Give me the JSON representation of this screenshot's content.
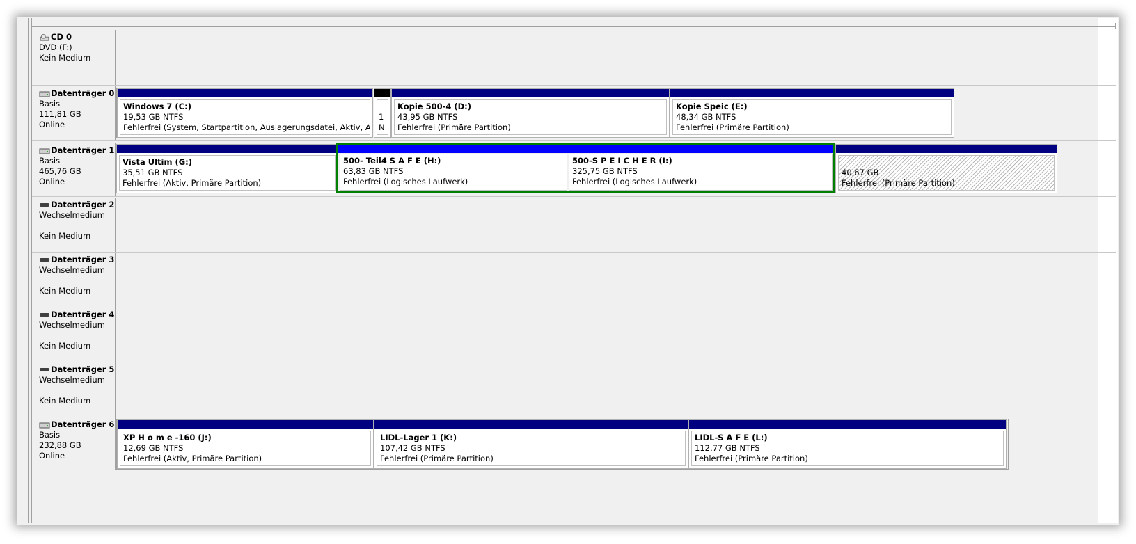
{
  "disks": [
    {
      "id": "cd0",
      "title": "CD 0",
      "icon": "cd-drive-icon",
      "lines": [
        "DVD (F:)",
        "",
        "Kein Medium"
      ]
    },
    {
      "id": "d0",
      "title": "Datenträger 0",
      "icon": "disk-icon",
      "lines": [
        "Basis",
        "111,81 GB",
        "Online"
      ],
      "partitions": [
        {
          "name": "Windows 7  (C:)",
          "size": "19,53 GB NTFS",
          "status": "Fehlerfrei (System, Startpartition, Auslagerungsdatei, Aktiv, Absturzabbild, Primäre Partition)"
        },
        {
          "name": "",
          "size": "1",
          "status": "N"
        },
        {
          "name": "Kopie 500-4  (D:)",
          "size": "43,95 GB NTFS",
          "status": "Fehlerfrei (Primäre Partition)"
        },
        {
          "name": "Kopie Speic  (E:)",
          "size": "48,34 GB NTFS",
          "status": "Fehlerfrei (Primäre Partition)"
        }
      ]
    },
    {
      "id": "d1",
      "title": "Datenträger 1",
      "icon": "disk-icon",
      "lines": [
        "Basis",
        "465,76 GB",
        "Online"
      ],
      "partitions": [
        {
          "name": "Vista Ultim  (G:)",
          "size": "35,51 GB NTFS",
          "status": "Fehlerfrei (Aktiv, Primäre Partition)"
        },
        {
          "name": "500- Teil4  S A F E  (H:)",
          "size": "63,83 GB NTFS",
          "status": "Fehlerfrei (Logisches Laufwerk)"
        },
        {
          "name": "500-S P E I C H E R  (I:)",
          "size": "325,75 GB NTFS",
          "status": "Fehlerfrei (Logisches Laufwerk)"
        },
        {
          "name": "",
          "size": "40,67 GB",
          "status": "Fehlerfrei (Primäre Partition)"
        }
      ]
    },
    {
      "id": "d2",
      "title": "Datenträger 2",
      "icon": "removable-drive-icon",
      "lines": [
        "Wechselmedium",
        "",
        "Kein Medium"
      ]
    },
    {
      "id": "d3",
      "title": "Datenträger 3",
      "icon": "removable-drive-icon",
      "lines": [
        "Wechselmedium",
        "",
        "Kein Medium"
      ]
    },
    {
      "id": "d4",
      "title": "Datenträger 4",
      "icon": "removable-drive-icon",
      "lines": [
        "Wechselmedium",
        "",
        "Kein Medium"
      ]
    },
    {
      "id": "d5",
      "title": "Datenträger 5",
      "icon": "removable-drive-icon",
      "lines": [
        "Wechselmedium",
        "",
        "Kein Medium"
      ]
    },
    {
      "id": "d6",
      "title": "Datenträger 6",
      "icon": "disk-icon",
      "lines": [
        "Basis",
        "232,88 GB",
        "Online"
      ],
      "partitions": [
        {
          "name": "XP H o m e -160  (J:)",
          "size": "12,69 GB NTFS",
          "status": "Fehlerfrei (Aktiv, Primäre Partition)"
        },
        {
          "name": "LIDL-Lager 1  (K:)",
          "size": "107,42 GB NTFS",
          "status": "Fehlerfrei (Primäre Partition)"
        },
        {
          "name": "LIDL-S A F E  (L:)",
          "size": "112,77 GB NTFS",
          "status": "Fehlerfrei (Primäre Partition)"
        }
      ]
    }
  ],
  "colors": {
    "primary_bar": "#000080",
    "logical_bar": "#0000ff",
    "extended_border": "#008000",
    "unallocated_bar": "#000000"
  }
}
